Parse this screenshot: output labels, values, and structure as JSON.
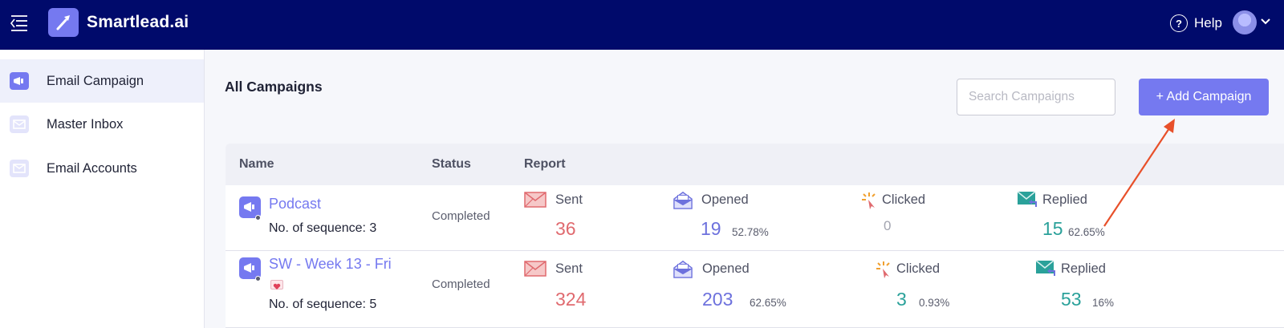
{
  "app": {
    "brand": "Smartlead.ai",
    "help_label": "Help"
  },
  "sidebar": {
    "items": [
      {
        "label": "Email Campaign",
        "icon": "megaphone-icon",
        "active": true
      },
      {
        "label": "Master Inbox",
        "icon": "inbox-icon",
        "active": false
      },
      {
        "label": "Email Accounts",
        "icon": "envelope-icon",
        "active": false
      }
    ]
  },
  "main": {
    "title": "All Campaigns",
    "search_placeholder": "Search Campaigns",
    "add_button": "+ Add Campaign"
  },
  "table": {
    "headers": {
      "name": "Name",
      "status": "Status",
      "report": "Report"
    },
    "metric_labels": {
      "sent": "Sent",
      "opened": "Opened",
      "clicked": "Clicked",
      "replied": "Replied"
    },
    "rows": [
      {
        "name": "Podcast",
        "sequence": "No. of sequence: 3",
        "status": "Completed",
        "sent": "36",
        "opened": "19",
        "opened_pct": "52.78%",
        "clicked": "0",
        "clicked_pct": "",
        "replied": "15",
        "replied_pct": "62.65%"
      },
      {
        "name": "SW - Week 13 - Fri",
        "sequence": "No. of sequence: 5",
        "status": "Completed",
        "sent": "324",
        "opened": "203",
        "opened_pct": "62.65%",
        "clicked": "3",
        "clicked_pct": "0.93%",
        "replied": "53",
        "replied_pct": "16%"
      }
    ]
  },
  "colors": {
    "topbar": "#000a6b",
    "accent": "#7579f0",
    "sent": "#e06a6f",
    "opened": "#6d71dd",
    "replied": "#2aa19a",
    "annotation_arrow": "#e8502a"
  }
}
